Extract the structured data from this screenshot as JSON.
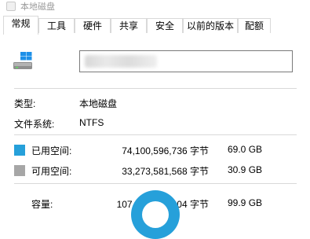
{
  "window": {
    "title": "本地磁盘"
  },
  "tabs": [
    {
      "label": "常规",
      "active": true
    },
    {
      "label": "工具"
    },
    {
      "label": "硬件"
    },
    {
      "label": "共享"
    },
    {
      "label": "安全"
    },
    {
      "label": "以前的版本"
    },
    {
      "label": "配额"
    }
  ],
  "general": {
    "type_label": "类型:",
    "type_value": "本地磁盘",
    "fs_label": "文件系统:",
    "fs_value": "NTFS",
    "used": {
      "label": "已用空间:",
      "bytes": "74,100,596,736 字节",
      "size": "69.0 GB",
      "color": "#26a0da"
    },
    "free": {
      "label": "可用空间:",
      "bytes": "33,273,581,568 字节",
      "size": "30.9 GB",
      "color": "#a6a6a6"
    },
    "capacity": {
      "label": "容量:",
      "bytes": "107,374,178,304 字节",
      "size": "99.9 GB"
    }
  },
  "icons": {
    "drive": "windows-drive-icon"
  },
  "colors": {
    "accent": "#26a0da",
    "free": "#a6a6a6",
    "border": "#d9d9d9"
  }
}
